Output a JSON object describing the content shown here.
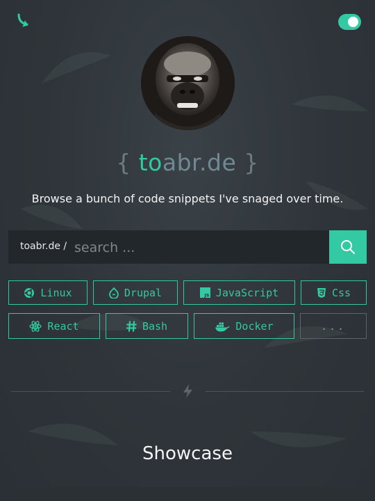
{
  "header": {
    "logo_icon": "curved-arrow-icon",
    "theme_toggle": {
      "icon": "toggle-icon",
      "state": "on",
      "accent": "#33c9a2"
    }
  },
  "profile": {
    "avatar": "gorilla-avatar"
  },
  "site_title": {
    "open_brace": "{",
    "part_to": "to",
    "part_rest": "abr.de",
    "close_brace": "}"
  },
  "tagline": "Browse a bunch of code snippets I've snaged over time.",
  "search": {
    "prefix": "toabr.de /",
    "placeholder": "search ...",
    "value": "",
    "button_icon": "search-icon"
  },
  "tags": [
    {
      "label": "Linux",
      "icon": "ubuntu-icon"
    },
    {
      "label": "Drupal",
      "icon": "drupal-icon"
    },
    {
      "label": "JavaScript",
      "icon": "js-icon"
    },
    {
      "label": "Css",
      "icon": "css3-icon"
    },
    {
      "label": "React",
      "icon": "react-icon"
    },
    {
      "label": "Bash",
      "icon": "hashtag-icon"
    },
    {
      "label": "Docker",
      "icon": "docker-icon"
    },
    {
      "label": "..."
    }
  ],
  "section_divider_icon": "bolt-icon",
  "showcase": {
    "title": "Showcase"
  },
  "colors": {
    "accent": "#33c9a2",
    "background": "#2e3439",
    "search_bg": "#22272b"
  }
}
